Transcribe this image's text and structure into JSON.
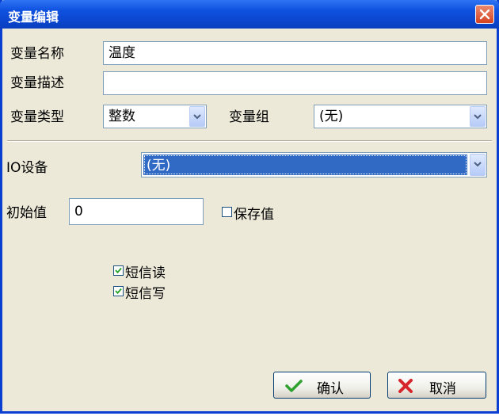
{
  "window": {
    "title": "变量编辑"
  },
  "form": {
    "name_label": "变量名称",
    "name_value": "温度",
    "desc_label": "变量描述",
    "desc_value": "",
    "type_label": "变量类型",
    "type_value": "整数",
    "group_label": "变量组",
    "group_value": "(无)",
    "io_label": "IO设备",
    "io_value": "(无)",
    "init_label": "初始值",
    "init_value": "0",
    "save_label": "保存值",
    "save_checked": false,
    "sms_read_label": "短信读",
    "sms_read_checked": true,
    "sms_write_label": "短信写",
    "sms_write_checked": true
  },
  "buttons": {
    "ok_label": "确认",
    "cancel_label": "取消"
  },
  "colors": {
    "title_bar": "#0a3fd1",
    "dialog_bg": "#ece9d8",
    "selection": "#316ac5",
    "ok_icon": "#2fa12f",
    "cancel_icon": "#d6262b"
  },
  "icons": {
    "close": "close-icon",
    "ok": "checkmark-icon",
    "cancel": "x-icon"
  }
}
